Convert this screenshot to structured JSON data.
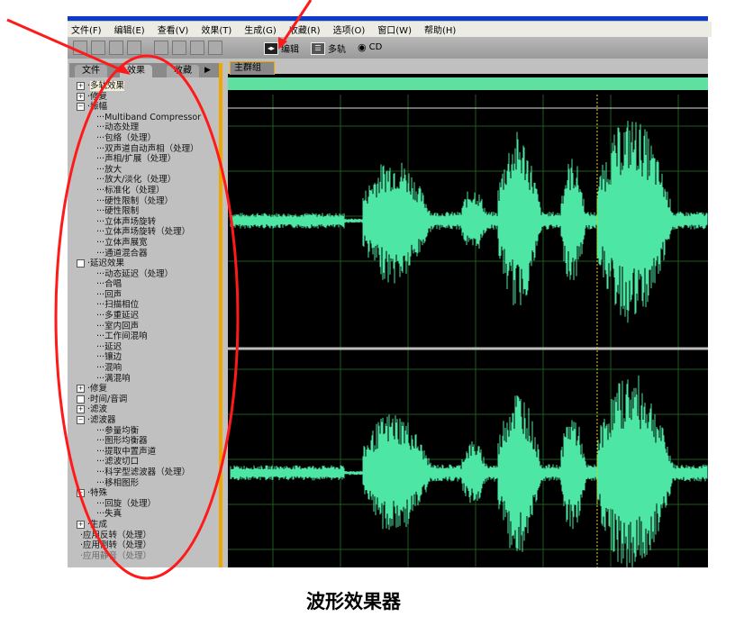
{
  "menu": [
    "文件(F)",
    "编辑(E)",
    "查看(V)",
    "效果(T)",
    "生成(G)",
    "收藏(R)",
    "选项(O)",
    "窗口(W)",
    "帮助(H)"
  ],
  "toolbar": {
    "edit_label": "编辑",
    "multitrack_label": "多轨",
    "cd_label": "CD"
  },
  "panel_tabs": [
    "文件",
    "效果",
    "收藏"
  ],
  "session_tab": "主群组",
  "tree": [
    {
      "label": "多轨效果",
      "level": 0,
      "box": "+",
      "selected": true
    },
    {
      "label": "修复",
      "level": 0,
      "box": "+"
    },
    {
      "label": "振幅",
      "level": 0,
      "box": "−"
    },
    {
      "label": "Multiband Compressor",
      "level": 1
    },
    {
      "label": "动态处理",
      "level": 1
    },
    {
      "label": "包络（处理）",
      "level": 1
    },
    {
      "label": "双声道自动声相（处理）",
      "level": 1
    },
    {
      "label": "声相/扩展（处理）",
      "level": 1
    },
    {
      "label": "放大",
      "level": 1
    },
    {
      "label": "放大/淡化（处理）",
      "level": 1
    },
    {
      "label": "标准化（处理）",
      "level": 1
    },
    {
      "label": "硬性限制（处理）",
      "level": 1
    },
    {
      "label": "硬性限制",
      "level": 1
    },
    {
      "label": "立体声场旋转",
      "level": 1
    },
    {
      "label": "立体声场旋转（处理）",
      "level": 1
    },
    {
      "label": "立体声展宽",
      "level": 1
    },
    {
      "label": "通道混合器",
      "level": 1
    },
    {
      "label": "延迟效果",
      "level": 0,
      "box": " "
    },
    {
      "label": "动态延迟（处理）",
      "level": 1
    },
    {
      "label": "合唱",
      "level": 1
    },
    {
      "label": "回声",
      "level": 1
    },
    {
      "label": "扫描相位",
      "level": 1
    },
    {
      "label": "多重延迟",
      "level": 1
    },
    {
      "label": "室内回声",
      "level": 1
    },
    {
      "label": "工作间混响",
      "level": 1
    },
    {
      "label": "延迟",
      "level": 1
    },
    {
      "label": "镶边",
      "level": 1
    },
    {
      "label": "混响",
      "level": 1
    },
    {
      "label": "满混响",
      "level": 1
    },
    {
      "label": "修复",
      "level": 0,
      "box": "+"
    },
    {
      "label": "时间/音调",
      "level": 0,
      "box": " "
    },
    {
      "label": "滤波",
      "level": 0,
      "box": "+"
    },
    {
      "label": "滤波器",
      "level": 0,
      "box": "−"
    },
    {
      "label": "参量均衡",
      "level": 1
    },
    {
      "label": "图形均衡器",
      "level": 1
    },
    {
      "label": "提取中置声道",
      "level": 1
    },
    {
      "label": "滤波切口",
      "level": 1
    },
    {
      "label": "科学型滤波器（处理）",
      "level": 1
    },
    {
      "label": "移相图形",
      "level": 1
    },
    {
      "label": "特殊",
      "level": 0,
      "box": "−"
    },
    {
      "label": "回旋（处理）",
      "level": 1
    },
    {
      "label": "失真",
      "level": 1
    },
    {
      "label": "生成",
      "level": 0,
      "box": "+"
    },
    {
      "label": "应用反转（处理）",
      "level": 0
    },
    {
      "label": "应用倒转（处理）",
      "level": 0
    },
    {
      "label": "应用静音（处理）",
      "level": 0,
      "disabled": true
    }
  ],
  "caption": "波形效果器",
  "colors": {
    "waveform": "#4de6a4",
    "annotation": "#ff1a1a",
    "scroll_accent": "#f0a800"
  }
}
